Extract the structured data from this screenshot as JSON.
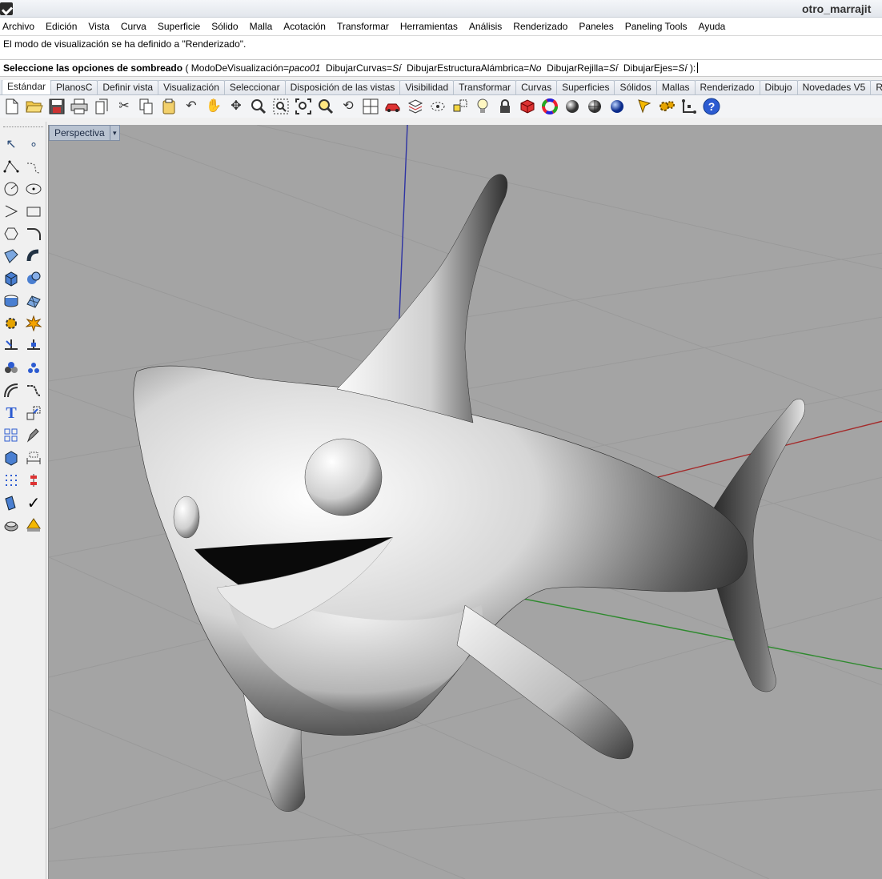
{
  "window": {
    "title": "otro_marrajit"
  },
  "menu": [
    "Archivo",
    "Edición",
    "Vista",
    "Curva",
    "Superficie",
    "Sólido",
    "Malla",
    "Acotación",
    "Transformar",
    "Herramientas",
    "Análisis",
    "Renderizado",
    "Paneles",
    "Paneling Tools",
    "Ayuda"
  ],
  "command": {
    "history": "El modo de visualización se ha definido a \"Renderizado\".",
    "prompt_label": "Seleccione las opciones de sombreado",
    "paren_open": "(",
    "opt1_name": "ModoDeVisualización=",
    "opt1_value": "paco01",
    "opt2_name": "DibujarCurvas=",
    "opt2_value": "Sí",
    "opt3_name": "DibujarEstructuraAlámbrica=",
    "opt3_value": "No",
    "opt4_name": "DibujarRejilla=",
    "opt4_value": "Sí",
    "opt5_name": "DibujarEjes=",
    "opt5_value": "Sí",
    "paren_close": "):"
  },
  "tabs": [
    "Estándar",
    "PlanosC",
    "Definir vista",
    "Visualización",
    "Seleccionar",
    "Disposición de las vistas",
    "Visibilidad",
    "Transformar",
    "Curvas",
    "Superficies",
    "Sólidos",
    "Mallas",
    "Renderizado",
    "Dibujo",
    "Novedades V5",
    "Refere"
  ],
  "active_tab": "Estándar",
  "toolbar_icons": [
    "new-file-icon",
    "open-file-icon",
    "save-icon",
    "print-icon",
    "import-icon",
    "cut-icon",
    "copy-icon",
    "paste-icon",
    "undo-icon",
    "pan-icon",
    "rotate-view-icon",
    "zoom-icon",
    "zoom-window-icon",
    "zoom-extents-icon",
    "zoom-selected-icon",
    "undo-view-icon",
    "four-viewports-icon",
    "car-icon",
    "layer-icon",
    "select-icon",
    "osnap-icon",
    "light-icon",
    "lock-icon",
    "material-icon",
    "color-wheel-icon",
    "sphere-render-icon",
    "sphere-shade-icon",
    "sphere-blue-icon",
    "pen-icon",
    "gear-icon",
    "gumball-icon",
    "help-icon"
  ],
  "sidebar_icons": [
    "pointer-icon",
    "point-icon",
    "polyline-icon",
    "curve-icon",
    "circle-icon",
    "ellipse-icon",
    "arc-icon",
    "rectangle-icon",
    "polygon-icon",
    "fillet-icon",
    "surface-icon",
    "loft-icon",
    "box-icon",
    "boolean-icon",
    "cylinder-icon",
    "mesh-icon",
    "gear-tool-icon",
    "explode-icon",
    "trim-icon",
    "split-icon",
    "join-icon",
    "group-icon",
    "offset-icon",
    "blend-icon",
    "text-icon",
    "scale-icon",
    "array-icon",
    "edit-icon",
    "solid-edit-icon",
    "dimension-icon",
    "grid-array-icon",
    "history-icon",
    "analyze-icon",
    "check-icon",
    "render-icon",
    "paint-icon"
  ],
  "viewport": {
    "label": "Perspectiva",
    "dropdown": "▾"
  }
}
